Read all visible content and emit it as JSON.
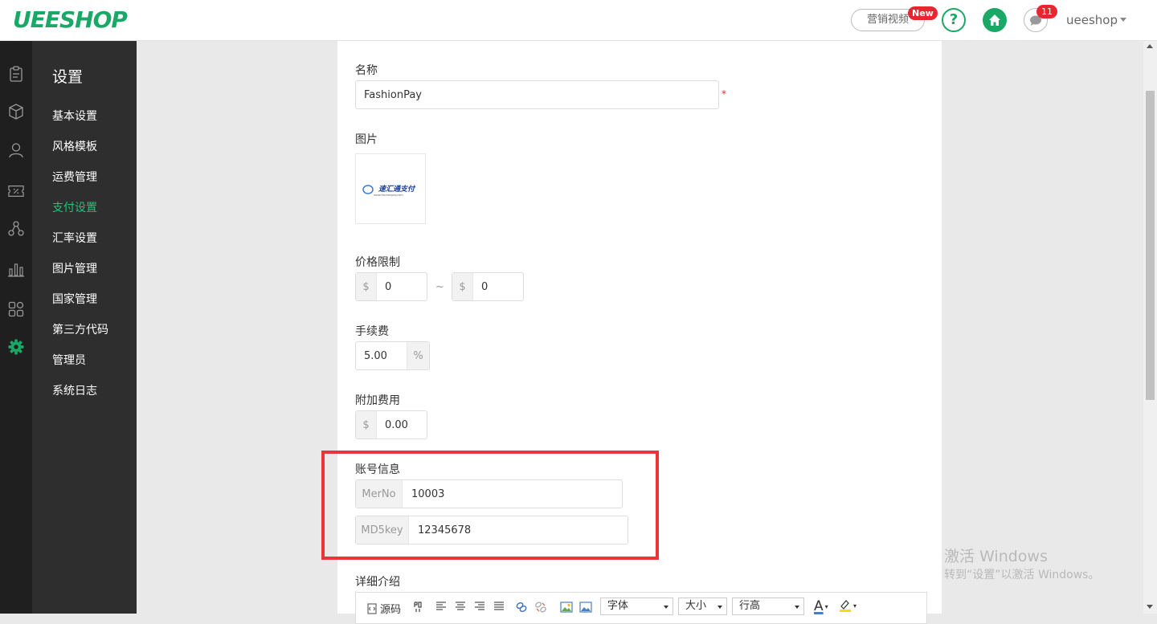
{
  "header": {
    "logo": "UEESHOP",
    "video_label": "营销视频",
    "new_badge": "New",
    "help_label": "?",
    "message_count": "11",
    "username": "ueeshop"
  },
  "rail": {
    "icons": [
      "clipboard-icon",
      "box-icon",
      "user-icon",
      "discount-icon",
      "nodes-icon",
      "bar-chart-icon",
      "apps-icon",
      "gear-icon"
    ]
  },
  "sidebar": {
    "title": "设置",
    "items": [
      "基本设置",
      "风格模板",
      "运费管理",
      "支付设置",
      "汇率设置",
      "图片管理",
      "国家管理",
      "第三方代码",
      "管理员",
      "系统日志"
    ],
    "active_index": 3
  },
  "form": {
    "name_label": "名称",
    "name_value": "FashionPay",
    "required_mark": "*",
    "image_label": "图片",
    "image_logo_text": "速汇通支付",
    "image_logo_sub": "www.fashionpay.com",
    "price_limit_label": "价格限制",
    "currency_symbol": "$",
    "price_min": "0",
    "price_max": "0",
    "range_sep": "~",
    "fee_label": "手续费",
    "fee_value": "5.00",
    "percent_sign": "%",
    "extra_fee_label": "附加费用",
    "extra_fee_value": "0.00",
    "account_label": "账号信息",
    "merno_label": "MerNo",
    "merno_value": "10003",
    "md5key_label": "MD5key",
    "md5key_value": "12345678",
    "detail_label": "详细介绍"
  },
  "editor": {
    "source_label": "源码",
    "font_label": "字体",
    "size_label": "大小",
    "line_height_label": "行高",
    "font_color_glyph": "A"
  },
  "watermark": {
    "line1": "激活 Windows",
    "line2": "转到“设置”以激活 Windows。"
  },
  "colors": {
    "brand": "#1aa867",
    "active_menu": "#22c37a",
    "badge": "#e8262f",
    "highlight": "#e8353b"
  }
}
